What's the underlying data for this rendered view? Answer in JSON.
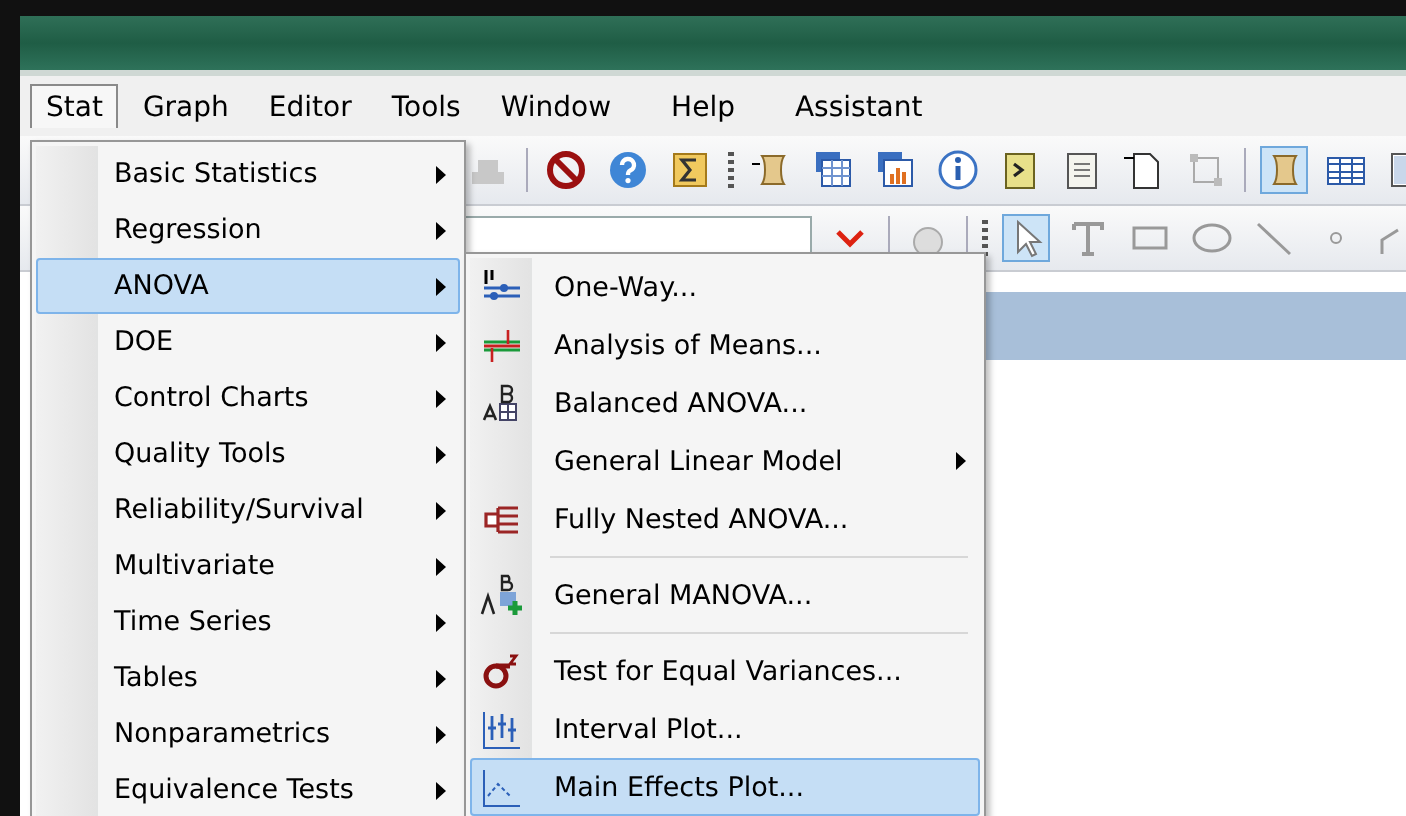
{
  "menubar": [
    {
      "label": "Stat",
      "selected": true
    },
    {
      "label": "Graph",
      "selected": false
    },
    {
      "label": "Editor",
      "selected": false
    },
    {
      "label": "Tools",
      "selected": false
    },
    {
      "label": "Window",
      "selected": false
    },
    {
      "label": "Help",
      "selected": false
    },
    {
      "label": "Assistant",
      "selected": false
    }
  ],
  "stat_menu": [
    {
      "label": "Basic Statistics",
      "submenu": true,
      "selected": false
    },
    {
      "label": "Regression",
      "submenu": true,
      "selected": false
    },
    {
      "label": "ANOVA",
      "submenu": true,
      "selected": true
    },
    {
      "label": "DOE",
      "submenu": true,
      "selected": false
    },
    {
      "label": "Control Charts",
      "submenu": true,
      "selected": false
    },
    {
      "label": "Quality Tools",
      "submenu": true,
      "selected": false
    },
    {
      "label": "Reliability/Survival",
      "submenu": true,
      "selected": false
    },
    {
      "label": "Multivariate",
      "submenu": true,
      "selected": false
    },
    {
      "label": "Time Series",
      "submenu": true,
      "selected": false
    },
    {
      "label": "Tables",
      "submenu": true,
      "selected": false
    },
    {
      "label": "Nonparametrics",
      "submenu": true,
      "selected": false
    },
    {
      "label": "Equivalence Tests",
      "submenu": true,
      "selected": false
    }
  ],
  "anova_menu": [
    {
      "kind": "item",
      "label": "One-Way...",
      "submenu": false,
      "selected": false
    },
    {
      "kind": "item",
      "label": "Analysis of Means...",
      "submenu": false,
      "selected": false
    },
    {
      "kind": "item",
      "label": "Balanced ANOVA...",
      "submenu": false,
      "selected": false
    },
    {
      "kind": "item",
      "label": "General Linear Model",
      "submenu": true,
      "selected": false
    },
    {
      "kind": "item",
      "label": "Fully Nested ANOVA...",
      "submenu": false,
      "selected": false
    },
    {
      "kind": "separator"
    },
    {
      "kind": "item",
      "label": "General MANOVA...",
      "submenu": false,
      "selected": false
    },
    {
      "kind": "separator"
    },
    {
      "kind": "item",
      "label": "Test for Equal Variances...",
      "submenu": false,
      "selected": false
    },
    {
      "kind": "item",
      "label": "Interval Plot...",
      "submenu": false,
      "selected": false
    },
    {
      "kind": "item",
      "label": "Main Effects Plot...",
      "submenu": false,
      "selected": true
    }
  ]
}
